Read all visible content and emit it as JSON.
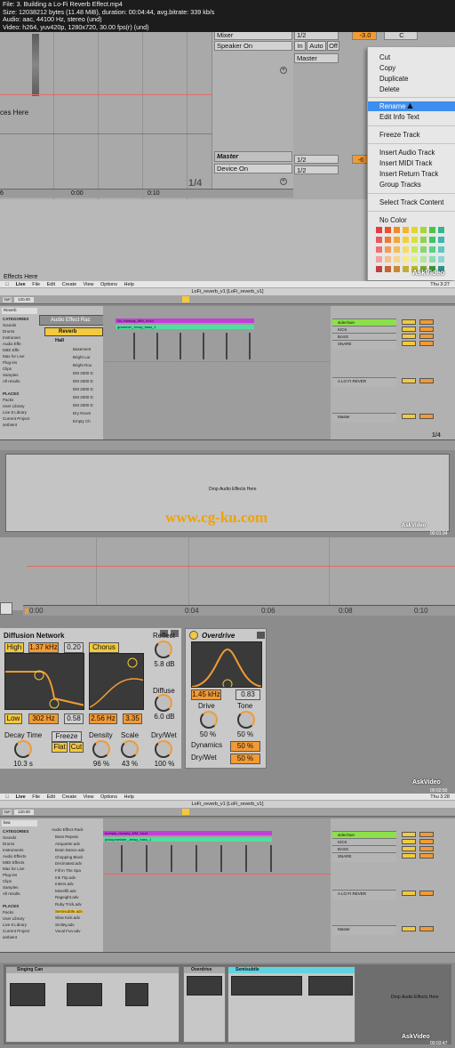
{
  "file_info": {
    "line1": "File: 3. Building a Lo-Fi Reverb Effect.mp4",
    "line2": "Size: 12038212 bytes (11.48 MiB), duration: 00:04:44, avg.bitrate: 339 kb/s",
    "line3": "Audio: aac, 44100 Hz, stereo (und)",
    "line4": "Video: h264, yuv420p, 1280x720, 30.00 fps(r) (und)"
  },
  "frame1": {
    "drop_text": "ces Here",
    "mixer_label": "Mixer",
    "speaker_label": "Speaker On",
    "in_label": "In",
    "auto_label": "Auto",
    "off_label": "Off",
    "master_route": "Master",
    "value_orange": "-3.0",
    "pan_value": "C",
    "master_track": "Master",
    "device_on": "Device On",
    "ch1": "1/2",
    "ch2": "1/2",
    "master_value": "-6",
    "time_sig": "1/4",
    "ruler_left": "6",
    "ruler_t1": "0:00",
    "ruler_t2": "0:10",
    "effects_here": "Effects Here",
    "watermark": "AskVideo",
    "context_menu": [
      "Cut",
      "Copy",
      "Duplicate",
      "Delete",
      "Rename",
      "Edit Info Text",
      "Freeze Track",
      "Insert Audio Track",
      "Insert MIDI Track",
      "Insert Return Track",
      "Group Tracks",
      "Select Track Content",
      "No Color"
    ],
    "swatch_colors": [
      "#e23c3c",
      "#e8542b",
      "#f08a2a",
      "#f5b52a",
      "#e3d62f",
      "#a9d43a",
      "#4fc14a",
      "#35b58c",
      "#e75a5a",
      "#f07a3a",
      "#f4a63b",
      "#f6cf3b",
      "#d9e23b",
      "#8fd44a",
      "#44c36b",
      "#3ab8b0",
      "#f07070",
      "#f39a55",
      "#f6bc5a",
      "#f8dc5a",
      "#c7e85a",
      "#86d96a",
      "#5ccf8c",
      "#5cc7c4",
      "#f4a0a0",
      "#f7bf8a",
      "#f8d38a",
      "#faea8a",
      "#ddf08a",
      "#b2e69a",
      "#8adcb0",
      "#8ad6d6",
      "#c04040",
      "#c86030",
      "#c88a30",
      "#c8ac30",
      "#b8b830",
      "#7aa830",
      "#389838",
      "#30908a"
    ]
  },
  "frame2": {
    "menu": [
      "Live",
      "File",
      "Edit",
      "Create",
      "View",
      "Options",
      "Help"
    ],
    "clock": "Thu 3:27",
    "window_title": "LoFi_reverb_v1  [LoFi_reverb_v1]",
    "tempo": "120.00",
    "browser_search": "Reverb",
    "folder_header": "Audio Effect Rac",
    "reverb_item": "Reverb",
    "hall_item": "Hall",
    "categories": [
      "CATEGORIES",
      "Sounds",
      "Drums",
      "Instrumen",
      "Audio Effe",
      "MIDI Effe",
      "Max for Live",
      "Plug-ins",
      "Clips",
      "Samples",
      "All results"
    ],
    "places": [
      "PLACES",
      "Packs",
      "User Library",
      "Live 8 Library",
      "Current Project",
      "ambient"
    ],
    "presets": [
      "Basement",
      "Bright Lar",
      "Bright Roo",
      "DM 2000 D",
      "DM 2000 D",
      "DM 2000 D",
      "DM 2000 D",
      "DM 2000 D",
      "Dry Room",
      "Empty Ch"
    ],
    "clip1": "Vo_Humpty_MM_Vox4",
    "clip2": "grammer_Jessy_bass_1",
    "tracks": [
      "sidechain",
      "KICK",
      "BASS",
      "SNARE",
      "A LO FI REVER",
      "Master"
    ],
    "mixer_vals": [
      "Mixer",
      "Speaker On",
      "1/2",
      "Master"
    ],
    "time_sig": "1/4",
    "drop_text": "Drop Audio Effects Here",
    "watermark_site": "www.cg-ku.com",
    "watermark": "AskVideo",
    "ts": "00:01:34"
  },
  "frame3": {
    "ruler_t1": "0:00",
    "ruler_t2": "0:04",
    "ruler_t3": "0:06",
    "ruler_t4": "0:08",
    "ruler_t5": "0:10",
    "ruler_t6": "0:12",
    "diffusion_title": "Diffusion Network",
    "high_label": "High",
    "high_freq": "1.37 kHz",
    "high_val": "0.20",
    "chorus_label": "Chorus",
    "low_label": "Low",
    "low_freq": "302 Hz",
    "low_val": "0.58",
    "low_freq2": "2.56 Hz",
    "low_val2": "3.35",
    "reflect_label": "Reflect",
    "reflect_val": "5.8 dB",
    "diffuse_label": "Diffuse",
    "diffuse_val": "6.0 dB",
    "decay_label": "Decay Time",
    "decay_val": "10.3 s",
    "freeze_label": "Freeze",
    "flat_label": "Flat",
    "cut_label": "Cut",
    "density_label": "Density",
    "density_val": "96 %",
    "scale_label": "Scale",
    "scale_val": "43 %",
    "drywet_label": "Dry/Wet",
    "drywet_val": "100 %",
    "overdrive_title": "Overdrive",
    "od_freq": "1.45 kHz",
    "od_val": "0.83",
    "drive_label": "Drive",
    "drive_val": "50 %",
    "tone_label": "Tone",
    "tone_val": "50 %",
    "dynamics_label": "Dynamics",
    "dynamics_val": "50 %",
    "od_drywet_label": "Dry/Wet",
    "od_drywet_val": "50 %",
    "watermark": "AskVideo",
    "ts": "00:02:50"
  },
  "frame4": {
    "menu": [
      "Live",
      "File",
      "Edit",
      "Create",
      "View",
      "Options",
      "Help"
    ],
    "clock": "Thu 3:28",
    "window_title": "LoFi_reverb_v1  [LoFi_reverb_v1]",
    "tempo": "120.00",
    "browser_search": "bea",
    "folder_header": "Audio Effect Rack",
    "presets": [
      "Bass Repeat",
      "Airquarter.adv",
      "Brain Dance.adv",
      "Chopping Block",
      "Decimated.adv",
      "Fill In The Spa",
      "Ink Trip.adv",
      "Intens.adv",
      "Mixrefill.adv",
      "Rageight.adv",
      "Ruby Trick.adv",
      "Semisubtle.adv",
      "Slow Kick.adv",
      "Smiley.adv",
      "Vocal Fun.adv"
    ],
    "categories": [
      "CATEGORIES",
      "Sounds",
      "Drums",
      "Instruments",
      "Audio Effects",
      "MIDI Effects",
      "Max for Live",
      "Plug-ins",
      "Clips",
      "Samples",
      "All results"
    ],
    "places": [
      "PLACES",
      "Packs",
      "User Library",
      "Live 8 Library",
      "Current Project",
      "ambient"
    ],
    "clip1": "humpty_dumpty_MM_Vox4",
    "clip2": "pickupmeister_Jessy_bass_1",
    "tracks": [
      "sidechain",
      "KICK",
      "BASS",
      "SNARE",
      "A LO FI REVER",
      "Master"
    ],
    "dev1": "Singing Can",
    "dev2": "Overdrive",
    "dev3": "Semisubtle",
    "drop_text": "Drop Audio Effects Here",
    "watermark": "AskVideo",
    "ts": "00:03:47"
  }
}
